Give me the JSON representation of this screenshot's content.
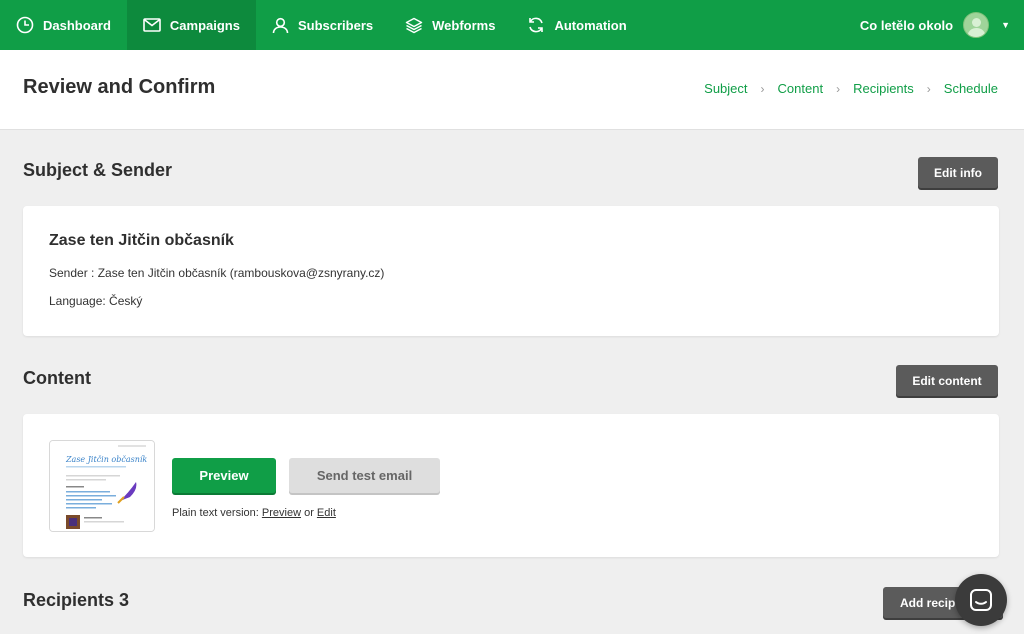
{
  "nav": {
    "items": [
      {
        "label": "Dashboard",
        "icon": "clock-icon"
      },
      {
        "label": "Campaigns",
        "icon": "envelope-icon"
      },
      {
        "label": "Subscribers",
        "icon": "user-icon"
      },
      {
        "label": "Webforms",
        "icon": "layers-icon"
      },
      {
        "label": "Automation",
        "icon": "refresh-icon"
      }
    ],
    "account_name": "Co letělo okolo"
  },
  "header": {
    "title": "Review and Confirm",
    "steps": [
      "Subject",
      "Content",
      "Recipients",
      "Schedule"
    ]
  },
  "subject_section": {
    "title": "Subject & Sender",
    "edit_label": "Edit info",
    "subject": "Zase ten Jitčin občasník",
    "sender": "Sender : Zase ten Jitčin občasník (rambouskova@zsnyrany.cz)",
    "language": "Language: Český"
  },
  "content_section": {
    "title": "Content",
    "edit_label": "Edit content",
    "thumbnail_title": "Zase Jitčin občasník",
    "preview_label": "Preview",
    "test_label": "Send test email",
    "plain_prefix": "Plain text version:",
    "plain_preview": "Preview",
    "plain_or": "or",
    "plain_edit": "Edit"
  },
  "recipients_section": {
    "title": "Recipients 3",
    "add_label": "Add recipi"
  },
  "colors": {
    "brand": "#109e47",
    "dark_button": "#5b5b5b"
  }
}
